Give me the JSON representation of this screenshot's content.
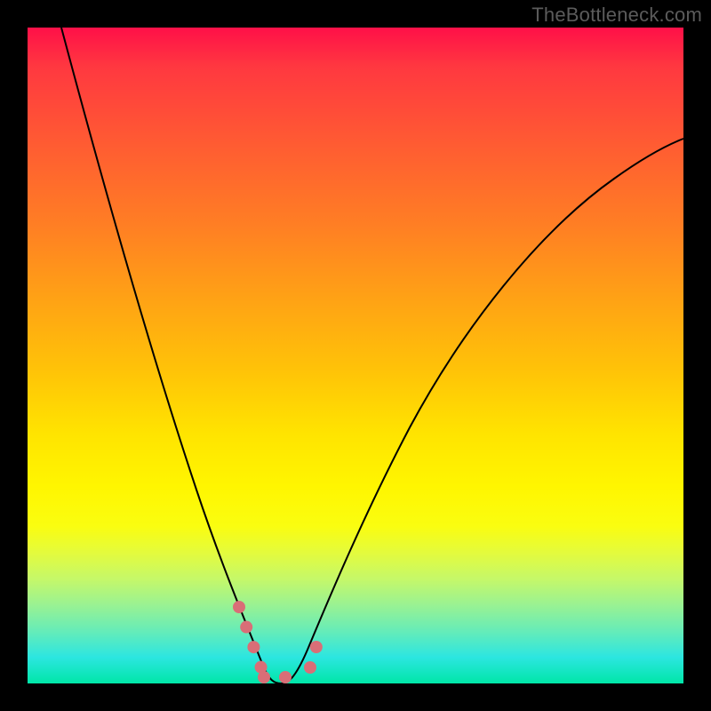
{
  "watermark": "TheBottleneck.com",
  "chart_data": {
    "type": "line",
    "title": "",
    "xlabel": "",
    "ylabel": "",
    "xlim": [
      0,
      100
    ],
    "ylim": [
      0,
      100
    ],
    "series": [
      {
        "name": "bottleneck-curve",
        "x": [
          5,
          8,
          12,
          16,
          20,
          24,
          27,
          30,
          32,
          34,
          36,
          37,
          38,
          40,
          43,
          47,
          52,
          58,
          65,
          75,
          85,
          95,
          100
        ],
        "values": [
          100,
          88,
          74,
          60,
          46,
          33,
          22,
          12,
          6,
          2,
          0,
          0,
          0,
          2,
          8,
          18,
          30,
          42,
          54,
          66,
          76,
          82,
          85
        ]
      }
    ],
    "annotations": [
      {
        "name": "highlight-dots",
        "points": [
          {
            "x": 32,
            "y": 12
          },
          {
            "x": 33,
            "y": 8
          },
          {
            "x": 34,
            "y": 5
          },
          {
            "x": 35,
            "y": 2
          },
          {
            "x": 35.5,
            "y": 1
          },
          {
            "x": 37.5,
            "y": 1
          },
          {
            "x": 39.5,
            "y": 1
          },
          {
            "x": 41,
            "y": 1
          },
          {
            "x": 42,
            "y": 5
          },
          {
            "x": 43,
            "y": 9
          }
        ]
      }
    ]
  },
  "colors": {
    "dot": "#D96E77",
    "curve": "#000000"
  }
}
